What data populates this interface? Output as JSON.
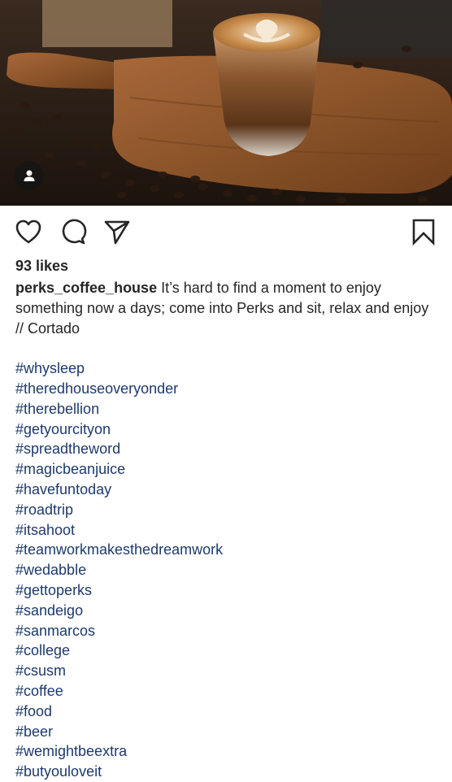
{
  "post": {
    "image_description": "coffee-cortado-photo",
    "likes": "93 likes",
    "username": "perks_coffee_house",
    "caption_text": "It’s hard to find a moment to enjoy something now a days; come into Perks and sit, relax and enjoy // Cortado",
    "hashtags": [
      "#whysleep",
      "#theredhouseoveryonder",
      "#therebellion",
      "#getyourcityon",
      "#spreadtheword",
      "#magicbeanjuice",
      "#havefuntoday",
      "#roadtrip",
      "#itsahoot",
      "#teamworkmakesthedreamwork",
      "#wedabble",
      "#gettoperks",
      "#sandeigo",
      "#sanmarcos",
      "#college",
      "#csusm",
      "#coffee",
      "#food",
      "#beer",
      "#wemightbeextra",
      "#butyouloveit"
    ]
  },
  "icons": {
    "avatar": "user-icon",
    "like": "heart-icon",
    "comment": "comment-bubble-icon",
    "share": "paper-plane-icon",
    "save": "bookmark-icon"
  },
  "colors": {
    "hashtag": "#1e3a6b",
    "text": "#262626"
  }
}
